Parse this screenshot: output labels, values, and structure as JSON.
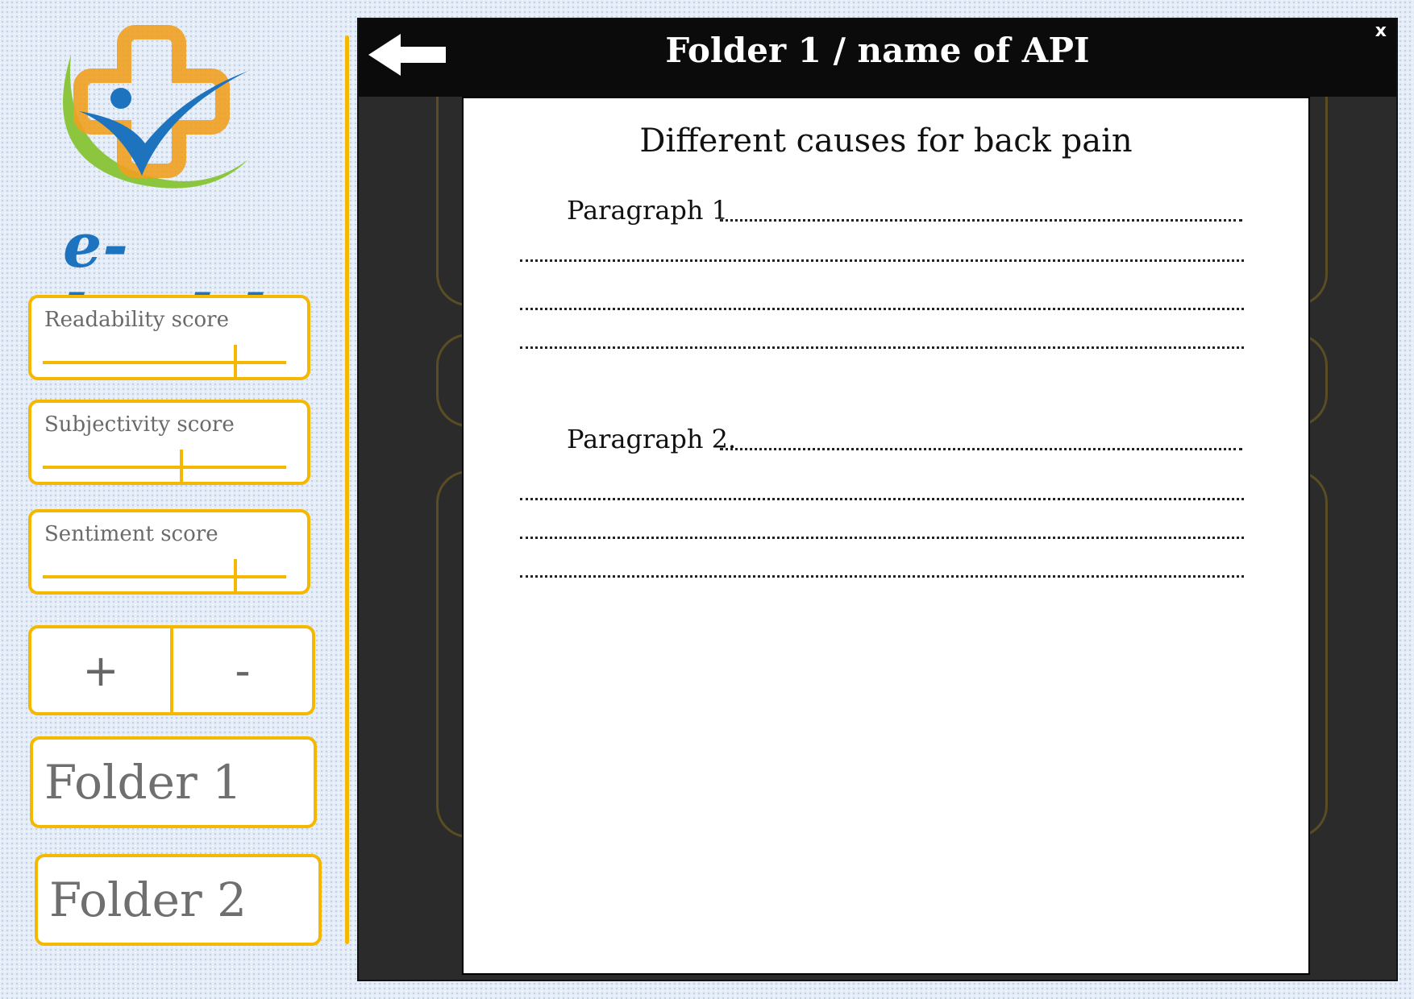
{
  "logo": {
    "text": "e-health",
    "colors": {
      "cross": "#f0a020",
      "figure": "#1e73be",
      "swoosh": "#8cc63f"
    }
  },
  "sidebar": {
    "scores": [
      {
        "label": "Readability score",
        "value_fraction": 0.79
      },
      {
        "label": "Subjectivity score",
        "value_fraction": 0.57
      },
      {
        "label": "Sentiment score",
        "value_fraction": 0.79
      }
    ],
    "zoom": {
      "plus": "+",
      "minus": "-"
    },
    "folders": [
      "Folder 1",
      "Folder 2"
    ]
  },
  "modal": {
    "title": "Folder 1 / name of API",
    "close": "x",
    "back_icon": "left-arrow-icon",
    "document": {
      "heading": "Different causes for back pain",
      "paragraphs": [
        {
          "label": "Paragraph 1 "
        },
        {
          "label": "Paragraph 2."
        }
      ]
    }
  },
  "colors": {
    "accent": "#f5b800",
    "header": "#0b0b0b",
    "panel": "#2b2b2b"
  }
}
